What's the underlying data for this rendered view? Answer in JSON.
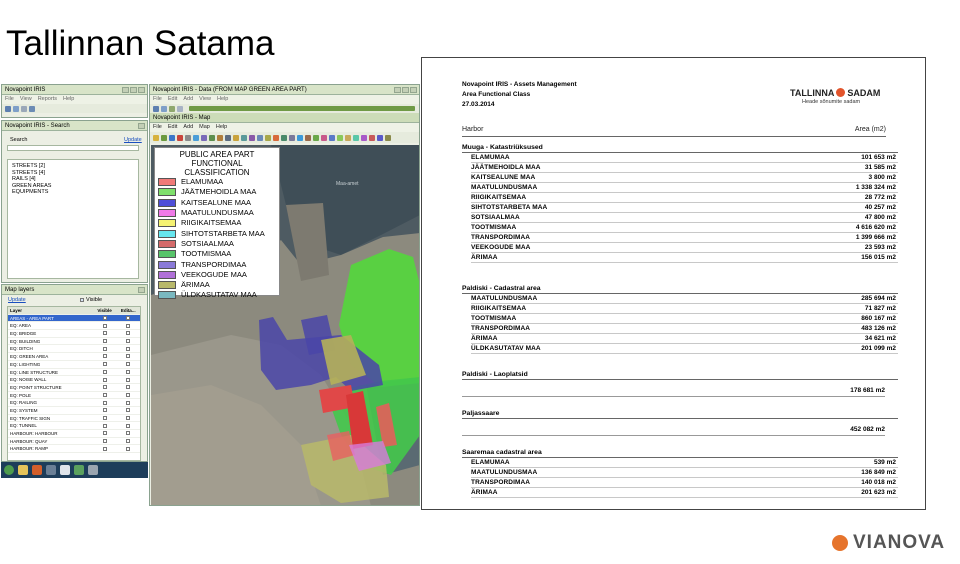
{
  "slide_title": "Tallinnan Satama",
  "iris_window": {
    "title": "Novapoint IRIS",
    "menu": [
      "File",
      "View",
      "Reports",
      "Help"
    ]
  },
  "search_panel": {
    "title": "Novapoint IRIS - Search",
    "search_label": "Search",
    "update_link": "Update",
    "tree": [
      "STREETS [2]",
      "STREETS [4]",
      "RAILS [4]",
      "GREEN AREAS",
      "EQUIPMENTS"
    ]
  },
  "layers_panel": {
    "title": "Map layers",
    "update_link": "Update",
    "visible_label": "Visible",
    "columns": [
      "Layer",
      "Visible",
      "Edita..."
    ],
    "rows": [
      "AREAS - AREA PART",
      "EQ: AREA",
      "EQ: BRIDGE",
      "EQ: BUILDING",
      "EQ: DITCH",
      "EQ: GREEN AREA",
      "EQ: LIGHTING",
      "EQ: LINE STRUCTURE",
      "EQ: NOISE WALL",
      "EQ: POINT STRUCTURE",
      "EQ: POLE",
      "EQ: RAILING",
      "EQ: SYSTEM",
      "EQ: TRAFFIC SIGN",
      "EQ: TUNNEL",
      "HARBOUR: HARBOUR",
      "HARBOUR: QUAY",
      "HARBOUR: RAMP"
    ]
  },
  "map_window": {
    "data_title": "Novapoint IRIS - Data  (FROM MAP GREEN AREA PART)",
    "data_menu": [
      "File",
      "Edit",
      "Add",
      "View",
      "Help"
    ],
    "map_title": "Novapoint IRIS - Map",
    "map_menu": [
      "File",
      "Edit",
      "Add",
      "Map",
      "Help"
    ],
    "sea_label": "Maa-amet"
  },
  "legend": {
    "title_line1": "PUBLIC AREA PART",
    "title_line2": "FUNCTIONAL CLASSIFICATION",
    "items": [
      {
        "label": "ELAMUMAA",
        "color": "#f07a78"
      },
      {
        "label": "JÄÄTMEHOIDLA MAA",
        "color": "#7fe06b"
      },
      {
        "label": "KAITSEALUNE MAA",
        "color": "#4f4fd8"
      },
      {
        "label": "MAATULUNDUSMAA",
        "color": "#f07ae8"
      },
      {
        "label": "RIIGIKAITSEMAA",
        "color": "#f5f272"
      },
      {
        "label": "SIHTOTSTARBETA MAA",
        "color": "#66e6ee"
      },
      {
        "label": "SOTSIAALMAA",
        "color": "#d46a6a"
      },
      {
        "label": "TOOTMISMAA",
        "color": "#58c46a"
      },
      {
        "label": "TRANSPORDIMAA",
        "color": "#8a7ad8"
      },
      {
        "label": "VEEKOGUDE MAA",
        "color": "#b070d8"
      },
      {
        "label": "ÄRIMAA",
        "color": "#b8b86a"
      },
      {
        "label": "ÜLDKASUTATAV MAA",
        "color": "#7ab8c0"
      }
    ]
  },
  "report": {
    "header_line1": "Novapoint IRIS - Assets Management",
    "header_line2": "Area Functional Class",
    "header_line3": "27.03.2014",
    "logo_text_a": "TALLINNA",
    "logo_text_b": "SADAM",
    "logo_sub": "Heade sõnumite sadam",
    "col_harbor": "Harbor",
    "col_area": "Area (m2)",
    "sections": [
      {
        "title": "Muuga - Katastriüksused",
        "rows": [
          {
            "name": "ELAMUMAA",
            "value": "101 653 m2"
          },
          {
            "name": "JÄÄTMEHOIDLA MAA",
            "value": "31 585 m2"
          },
          {
            "name": "KAITSEALUNE MAA",
            "value": "3 800 m2"
          },
          {
            "name": "MAATULUNDUSMAA",
            "value": "1 338 324 m2"
          },
          {
            "name": "RIIGIKAITSEMAA",
            "value": "28 772 m2"
          },
          {
            "name": "SIHTOTSTARBETA MAA",
            "value": "40 257 m2"
          },
          {
            "name": "SOTSIAALMAA",
            "value": "47 800 m2"
          },
          {
            "name": "TOOTMISMAA",
            "value": "4 616 620 m2"
          },
          {
            "name": "TRANSPORDIMAA",
            "value": "1 399 666 m2"
          },
          {
            "name": "VEEKOGUDE MAA",
            "value": "23 593 m2"
          },
          {
            "name": "ÄRIMAA",
            "value": "156 015 m2"
          }
        ]
      },
      {
        "title": "Paldiski - Cadastral area",
        "rows": [
          {
            "name": "MAATULUNDUSMAA",
            "value": "285 694 m2"
          },
          {
            "name": "RIIGIKAITSEMAA",
            "value": "71 827 m2"
          },
          {
            "name": "TOOTMISMAA",
            "value": "860 167 m2"
          },
          {
            "name": "TRANSPORDIMAA",
            "value": "483 126 m2"
          },
          {
            "name": "ÄRIMAA",
            "value": "34 621 m2"
          },
          {
            "name": "ÜLDKASUTATAV MAA",
            "value": "201 099 m2"
          }
        ]
      },
      {
        "title": "Paldiski - Laoplatsid",
        "total": "178 681 m2"
      },
      {
        "title": "Paljassaare",
        "total": "452 082 m2"
      },
      {
        "title": "Saaremaa cadastral area",
        "rows": [
          {
            "name": "ELAMUMAA",
            "value": "539 m2"
          },
          {
            "name": "MAATULUNDUSMAA",
            "value": "136 849 m2"
          },
          {
            "name": "TRANSPORDIMAA",
            "value": "140 018 m2"
          },
          {
            "name": "ÄRIMAA",
            "value": "201 623 m2"
          }
        ]
      }
    ]
  },
  "brand": "VIANOVA"
}
